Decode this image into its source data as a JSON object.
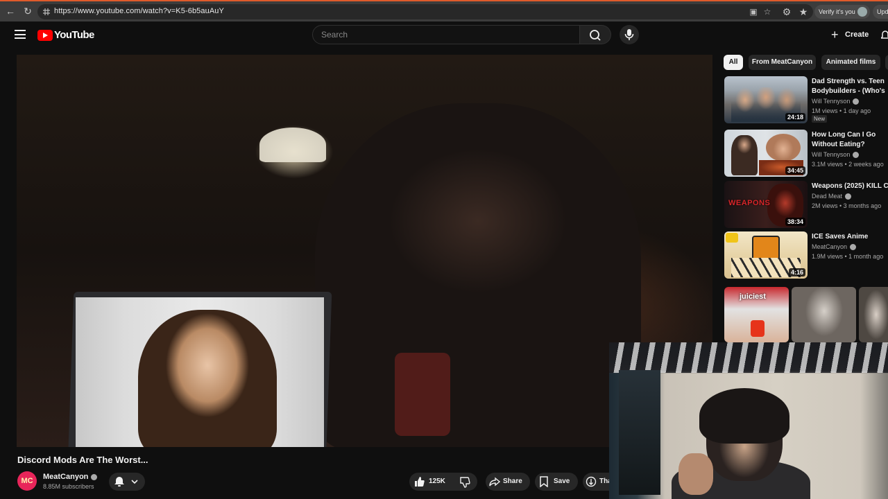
{
  "browser": {
    "url": "https://www.youtube.com/watch?v=K5-6b5auAuY",
    "verify_label": "Verify it's you",
    "update_label": "Update"
  },
  "header": {
    "logo_text": "YouTube",
    "search_placeholder": "Search",
    "create_label": "Create"
  },
  "video": {
    "title": "Discord Mods Are The Worst...",
    "channel": {
      "name": "MeatCanyon",
      "avatar_text": "MC",
      "subscribers": "8.85M subscribers"
    },
    "actions": {
      "likes": "125K",
      "share": "Share",
      "save": "Save",
      "thanks": "Thanks"
    }
  },
  "chips": [
    {
      "label": "All",
      "active": true
    },
    {
      "label": "From MeatCanyon",
      "active": false
    },
    {
      "label": "Animated films",
      "active": false
    }
  ],
  "recommendations": [
    {
      "title": "Dad Strength vs. Teen Bodybuilders - (Who's ...",
      "channel": "Will Tennyson",
      "meta": "1M views • 1 day ago",
      "badge": "New",
      "duration": "24:18"
    },
    {
      "title": "How Long Can I Go Without Eating? (Experiment)",
      "channel": "Will Tennyson",
      "meta": "3.1M views • 2 weeks ago",
      "duration": "34:45"
    },
    {
      "title": "Weapons (2025) KILL COUNT",
      "channel": "Dead Meat",
      "meta": "2M views • 3 months ago",
      "duration": "38:34",
      "thumb_text": "WEAPONS"
    },
    {
      "title": "ICE Saves Anime",
      "channel": "MeatCanyon",
      "meta": "1.9M views • 1 month ago",
      "duration": "4:16"
    }
  ],
  "shorts": [
    {
      "label": "juiciest"
    }
  ],
  "colors": {
    "brand_red": "#ff0000",
    "background": "#0f0f0f",
    "chip_bg": "#272727"
  }
}
